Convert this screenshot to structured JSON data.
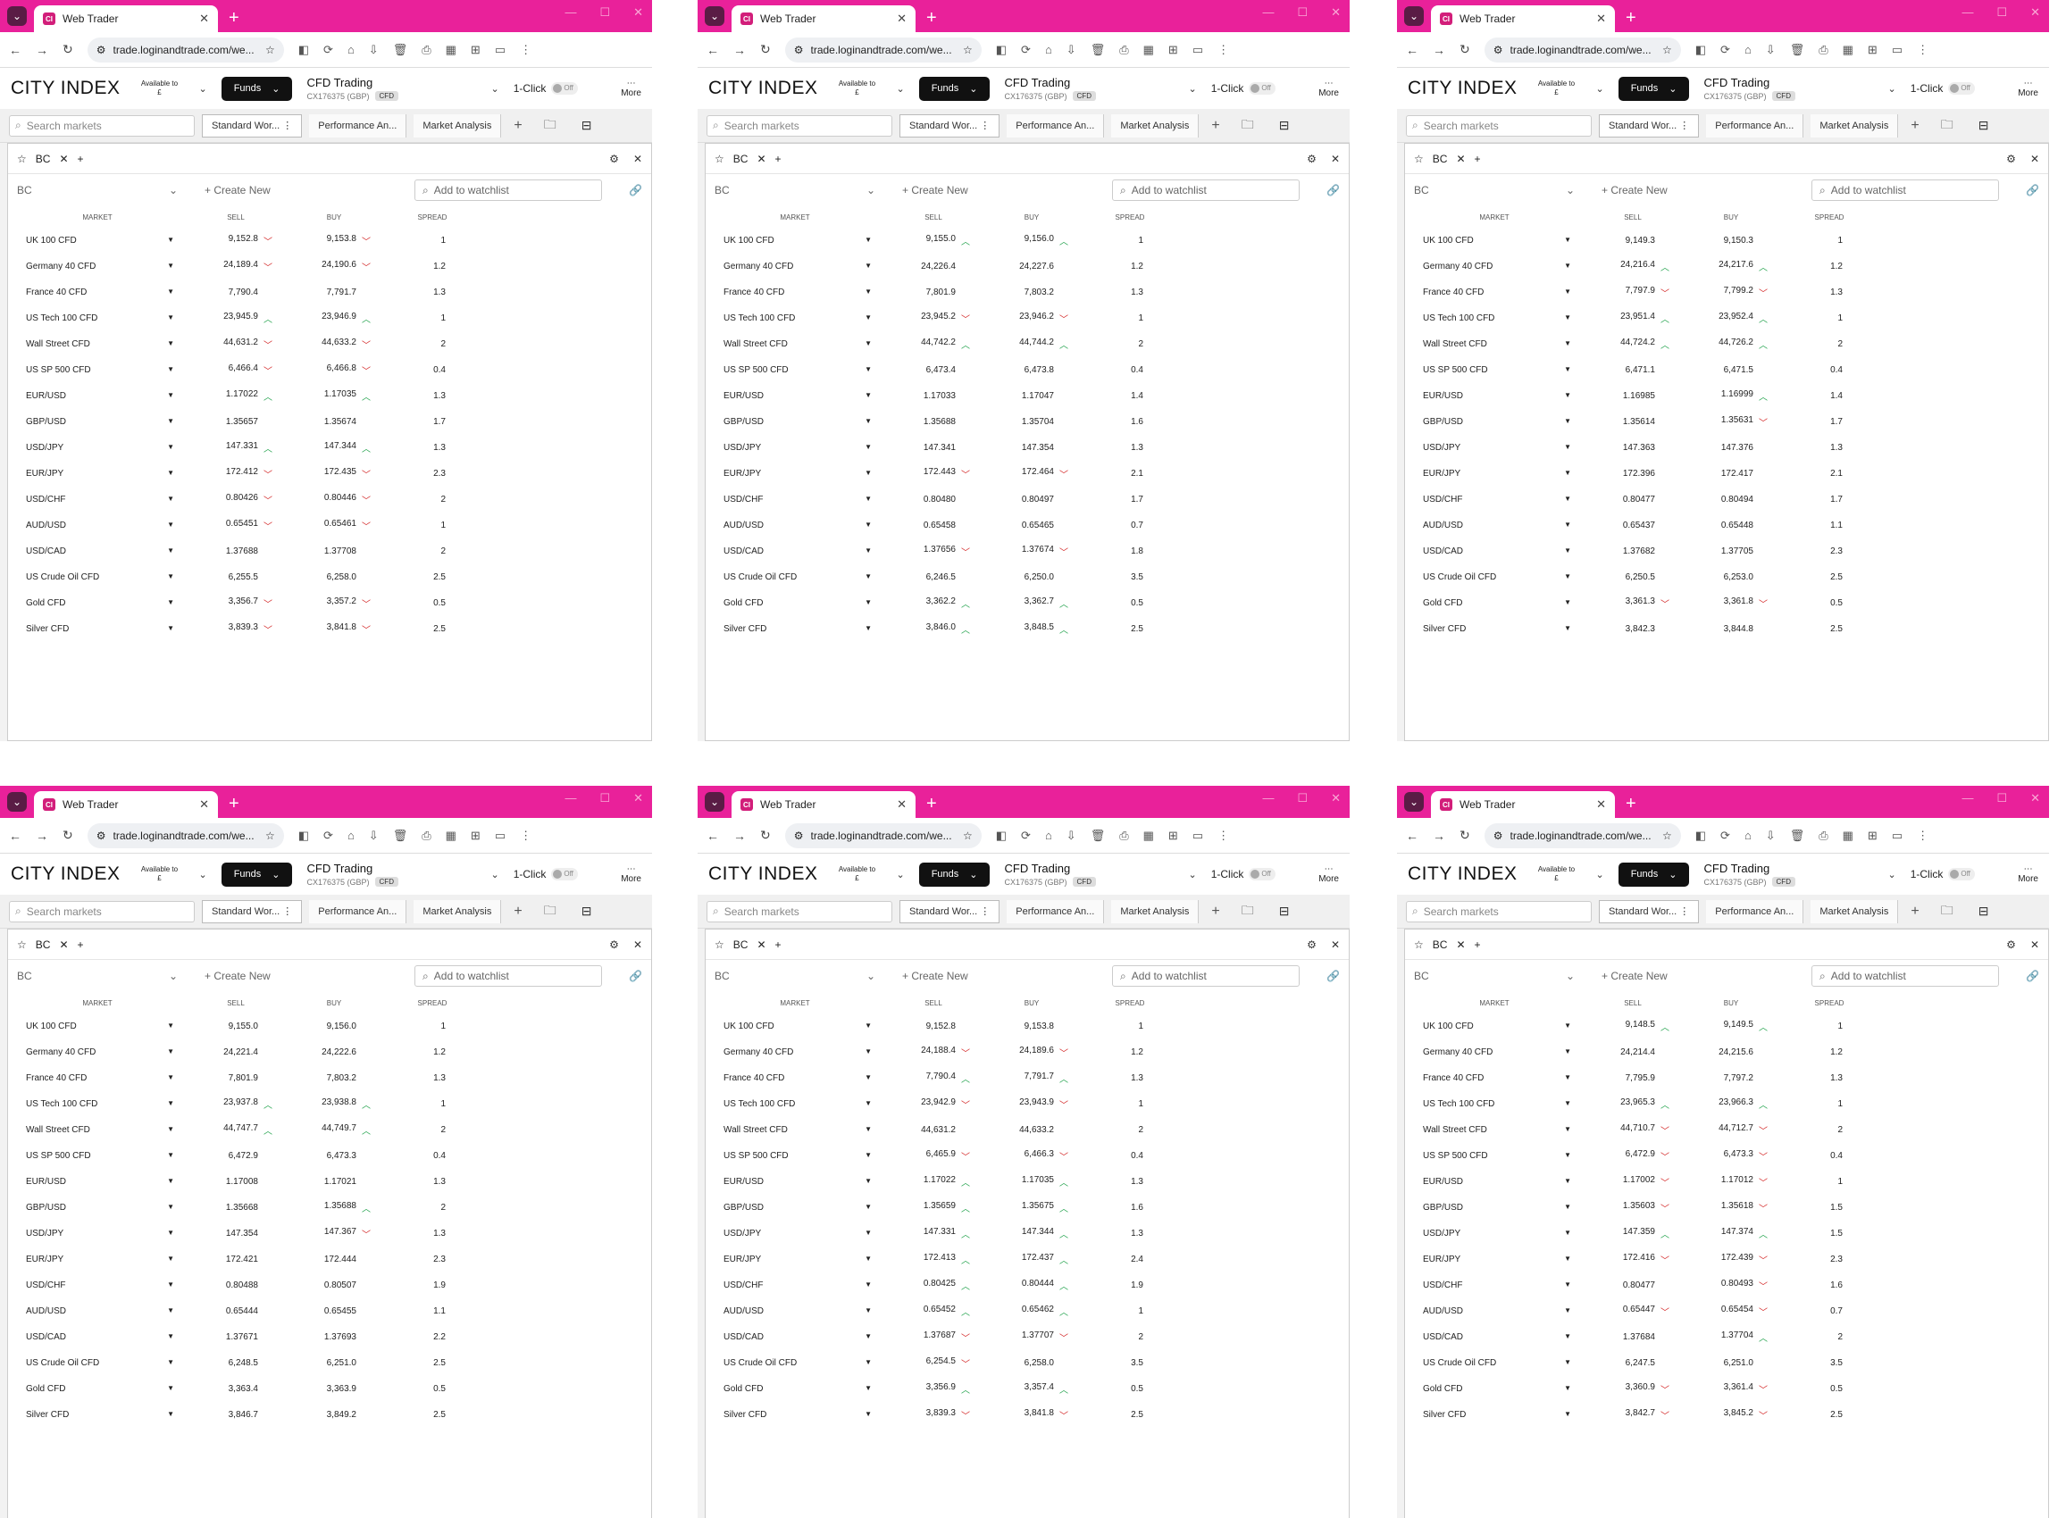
{
  "browser": {
    "tab_title": "Web Trader",
    "tab_logo_text": "CI",
    "url": "trade.loginandtrade.com/we...",
    "menu_icon": "chevron-down-icon"
  },
  "app": {
    "logo": "CITY INDEX",
    "available_label": "Available to",
    "available_currency": "£",
    "funds_label": "Funds",
    "account_name": "CFD Trading",
    "account_id": "CX176375 (GBP)",
    "account_badge": "CFD",
    "oneclick_label": "1-Click",
    "oneclick_state": "Off",
    "more_label": "More",
    "search_placeholder": "Search markets",
    "tabs": [
      "Standard Wor...",
      "Performance An...",
      "Market Analysis"
    ],
    "panel_tab": "BC",
    "watchlist_name": "BC",
    "create_new": "+ Create New",
    "add_watchlist": "Add to watchlist"
  },
  "columns": [
    "MARKET",
    "SELL",
    "BUY",
    "SPREAD"
  ],
  "markets": [
    "UK 100 CFD",
    "Germany 40 CFD",
    "France 40 CFD",
    "US Tech 100 CFD",
    "Wall Street CFD",
    "US SP 500 CFD",
    "EUR/USD",
    "GBP/USD",
    "USD/JPY",
    "EUR/JPY",
    "USD/CHF",
    "AUD/USD",
    "USD/CAD",
    "US Crude Oil CFD",
    "Gold CFD",
    "Silver CFD"
  ],
  "screenshots": [
    {
      "rows": [
        [
          "9,152.8",
          "d",
          "9,153.8",
          "d",
          "1"
        ],
        [
          "24,189.4",
          "d",
          "24,190.6",
          "d",
          "1.2"
        ],
        [
          "7,790.4",
          "",
          "7,791.7",
          "",
          "1.3"
        ],
        [
          "23,945.9",
          "u",
          "23,946.9",
          "u",
          "1"
        ],
        [
          "44,631.2",
          "d",
          "44,633.2",
          "d",
          "2"
        ],
        [
          "6,466.4",
          "d",
          "6,466.8",
          "d",
          "0.4"
        ],
        [
          "1.17022",
          "u",
          "1.17035",
          "u",
          "1.3"
        ],
        [
          "1.35657",
          "",
          "1.35674",
          "",
          "1.7"
        ],
        [
          "147.331",
          "u",
          "147.344",
          "u",
          "1.3"
        ],
        [
          "172.412",
          "d",
          "172.435",
          "d",
          "2.3"
        ],
        [
          "0.80426",
          "d",
          "0.80446",
          "d",
          "2"
        ],
        [
          "0.65451",
          "d",
          "0.65461",
          "d",
          "1"
        ],
        [
          "1.37688",
          "",
          "1.37708",
          "",
          "2"
        ],
        [
          "6,255.5",
          "",
          "6,258.0",
          "",
          "2.5"
        ],
        [
          "3,356.7",
          "d",
          "3,357.2",
          "d",
          "0.5"
        ],
        [
          "3,839.3",
          "d",
          "3,841.8",
          "d",
          "2.5"
        ]
      ]
    },
    {
      "rows": [
        [
          "9,155.0",
          "u",
          "9,156.0",
          "u",
          "1"
        ],
        [
          "24,226.4",
          "",
          "24,227.6",
          "",
          "1.2"
        ],
        [
          "7,801.9",
          "",
          "7,803.2",
          "",
          "1.3"
        ],
        [
          "23,945.2",
          "d",
          "23,946.2",
          "d",
          "1"
        ],
        [
          "44,742.2",
          "u",
          "44,744.2",
          "u",
          "2"
        ],
        [
          "6,473.4",
          "",
          "6,473.8",
          "",
          "0.4"
        ],
        [
          "1.17033",
          "",
          "1.17047",
          "",
          "1.4"
        ],
        [
          "1.35688",
          "",
          "1.35704",
          "",
          "1.6"
        ],
        [
          "147.341",
          "",
          "147.354",
          "",
          "1.3"
        ],
        [
          "172.443",
          "d",
          "172.464",
          "d",
          "2.1"
        ],
        [
          "0.80480",
          "",
          "0.80497",
          "",
          "1.7"
        ],
        [
          "0.65458",
          "",
          "0.65465",
          "",
          "0.7"
        ],
        [
          "1.37656",
          "d",
          "1.37674",
          "d",
          "1.8"
        ],
        [
          "6,246.5",
          "",
          "6,250.0",
          "",
          "3.5"
        ],
        [
          "3,362.2",
          "u",
          "3,362.7",
          "u",
          "0.5"
        ],
        [
          "3,846.0",
          "u",
          "3,848.5",
          "u",
          "2.5"
        ]
      ]
    },
    {
      "rows": [
        [
          "9,149.3",
          "",
          "9,150.3",
          "",
          "1"
        ],
        [
          "24,216.4",
          "u",
          "24,217.6",
          "u",
          "1.2"
        ],
        [
          "7,797.9",
          "d",
          "7,799.2",
          "d",
          "1.3"
        ],
        [
          "23,951.4",
          "u",
          "23,952.4",
          "u",
          "1"
        ],
        [
          "44,724.2",
          "u",
          "44,726.2",
          "u",
          "2"
        ],
        [
          "6,471.1",
          "",
          "6,471.5",
          "",
          "0.4"
        ],
        [
          "1.16985",
          "",
          "1.16999",
          "u",
          "1.4"
        ],
        [
          "1.35614",
          "",
          "1.35631",
          "d",
          "1.7"
        ],
        [
          "147.363",
          "",
          "147.376",
          "",
          "1.3"
        ],
        [
          "172.396",
          "",
          "172.417",
          "",
          "2.1"
        ],
        [
          "0.80477",
          "",
          "0.80494",
          "",
          "1.7"
        ],
        [
          "0.65437",
          "",
          "0.65448",
          "",
          "1.1"
        ],
        [
          "1.37682",
          "",
          "1.37705",
          "",
          "2.3"
        ],
        [
          "6,250.5",
          "",
          "6,253.0",
          "",
          "2.5"
        ],
        [
          "3,361.3",
          "d",
          "3,361.8",
          "d",
          "0.5"
        ],
        [
          "3,842.3",
          "",
          "3,844.8",
          "",
          "2.5"
        ]
      ]
    },
    {
      "rows": [
        [
          "9,155.0",
          "",
          "9,156.0",
          "",
          "1"
        ],
        [
          "24,221.4",
          "",
          "24,222.6",
          "",
          "1.2"
        ],
        [
          "7,801.9",
          "",
          "7,803.2",
          "",
          "1.3"
        ],
        [
          "23,937.8",
          "u",
          "23,938.8",
          "u",
          "1"
        ],
        [
          "44,747.7",
          "u",
          "44,749.7",
          "u",
          "2"
        ],
        [
          "6,472.9",
          "",
          "6,473.3",
          "",
          "0.4"
        ],
        [
          "1.17008",
          "",
          "1.17021",
          "",
          "1.3"
        ],
        [
          "1.35668",
          "",
          "1.35688",
          "u",
          "2"
        ],
        [
          "147.354",
          "",
          "147.367",
          "d",
          "1.3"
        ],
        [
          "172.421",
          "",
          "172.444",
          "",
          "2.3"
        ],
        [
          "0.80488",
          "",
          "0.80507",
          "",
          "1.9"
        ],
        [
          "0.65444",
          "",
          "0.65455",
          "",
          "1.1"
        ],
        [
          "1.37671",
          "",
          "1.37693",
          "",
          "2.2"
        ],
        [
          "6,248.5",
          "",
          "6,251.0",
          "",
          "2.5"
        ],
        [
          "3,363.4",
          "",
          "3,363.9",
          "",
          "0.5"
        ],
        [
          "3,846.7",
          "",
          "3,849.2",
          "",
          "2.5"
        ]
      ]
    },
    {
      "rows": [
        [
          "9,152.8",
          "",
          "9,153.8",
          "",
          "1"
        ],
        [
          "24,188.4",
          "d",
          "24,189.6",
          "d",
          "1.2"
        ],
        [
          "7,790.4",
          "u",
          "7,791.7",
          "u",
          "1.3"
        ],
        [
          "23,942.9",
          "d",
          "23,943.9",
          "d",
          "1"
        ],
        [
          "44,631.2",
          "",
          "44,633.2",
          "",
          "2"
        ],
        [
          "6,465.9",
          "d",
          "6,466.3",
          "d",
          "0.4"
        ],
        [
          "1.17022",
          "u",
          "1.17035",
          "u",
          "1.3"
        ],
        [
          "1.35659",
          "u",
          "1.35675",
          "u",
          "1.6"
        ],
        [
          "147.331",
          "u",
          "147.344",
          "u",
          "1.3"
        ],
        [
          "172.413",
          "u",
          "172.437",
          "u",
          "2.4"
        ],
        [
          "0.80425",
          "u",
          "0.80444",
          "u",
          "1.9"
        ],
        [
          "0.65452",
          "u",
          "0.65462",
          "u",
          "1"
        ],
        [
          "1.37687",
          "d",
          "1.37707",
          "d",
          "2"
        ],
        [
          "6,254.5",
          "d",
          "6,258.0",
          "",
          "3.5"
        ],
        [
          "3,356.9",
          "u",
          "3,357.4",
          "u",
          "0.5"
        ],
        [
          "3,839.3",
          "d",
          "3,841.8",
          "d",
          "2.5"
        ]
      ]
    },
    {
      "rows": [
        [
          "9,148.5",
          "u",
          "9,149.5",
          "u",
          "1"
        ],
        [
          "24,214.4",
          "",
          "24,215.6",
          "",
          "1.2"
        ],
        [
          "7,795.9",
          "",
          "7,797.2",
          "",
          "1.3"
        ],
        [
          "23,965.3",
          "u",
          "23,966.3",
          "u",
          "1"
        ],
        [
          "44,710.7",
          "d",
          "44,712.7",
          "d",
          "2"
        ],
        [
          "6,472.9",
          "d",
          "6,473.3",
          "d",
          "0.4"
        ],
        [
          "1.17002",
          "d",
          "1.17012",
          "d",
          "1"
        ],
        [
          "1.35603",
          "d",
          "1.35618",
          "d",
          "1.5"
        ],
        [
          "147.359",
          "u",
          "147.374",
          "u",
          "1.5"
        ],
        [
          "172.416",
          "d",
          "172.439",
          "d",
          "2.3"
        ],
        [
          "0.80477",
          "",
          "0.80493",
          "d",
          "1.6"
        ],
        [
          "0.65447",
          "d",
          "0.65454",
          "d",
          "0.7"
        ],
        [
          "1.37684",
          "",
          "1.37704",
          "u",
          "2"
        ],
        [
          "6,247.5",
          "",
          "6,251.0",
          "",
          "3.5"
        ],
        [
          "3,360.9",
          "d",
          "3,361.4",
          "d",
          "0.5"
        ],
        [
          "3,842.7",
          "d",
          "3,845.2",
          "d",
          "2.5"
        ]
      ]
    }
  ]
}
